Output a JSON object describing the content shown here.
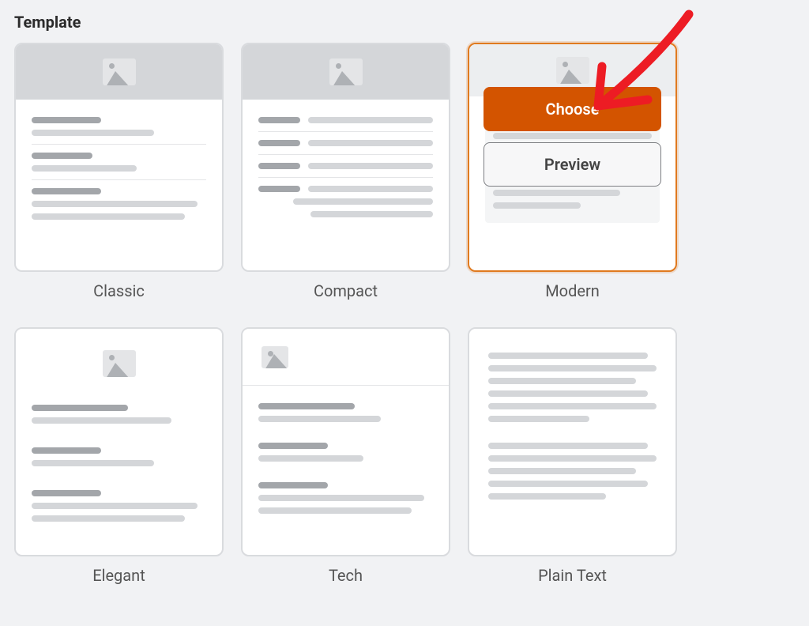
{
  "section": {
    "title": "Template"
  },
  "templates": [
    {
      "name": "Classic",
      "selected": false
    },
    {
      "name": "Compact",
      "selected": false
    },
    {
      "name": "Modern",
      "selected": true
    },
    {
      "name": "Elegant",
      "selected": false
    },
    {
      "name": "Tech",
      "selected": false
    },
    {
      "name": "Plain Text",
      "selected": false
    }
  ],
  "actions": {
    "choose_label": "Choose",
    "preview_label": "Preview"
  },
  "colors": {
    "accent": "#d35400",
    "selected_border": "#e07a1f",
    "annotation": "#ed1c24"
  }
}
